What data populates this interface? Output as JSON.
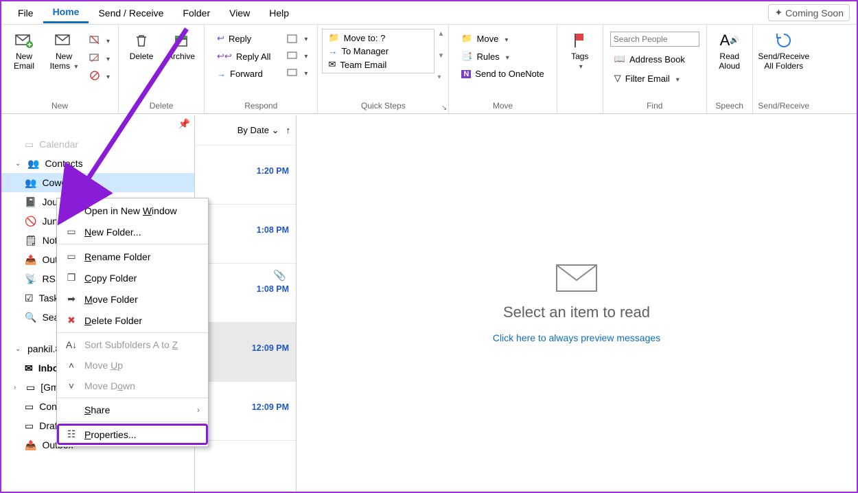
{
  "menu": {
    "file": "File",
    "home": "Home",
    "sendrecv": "Send / Receive",
    "folder": "Folder",
    "view": "View",
    "help": "Help",
    "coming": "Coming Soon"
  },
  "ribbon": {
    "new": {
      "label": "New",
      "email": "New Email",
      "items": "New Items"
    },
    "delete": {
      "label": "Delete",
      "delete": "Delete",
      "archive": "Archive"
    },
    "respond": {
      "label": "Respond",
      "reply": "Reply",
      "replyall": "Reply All",
      "forward": "Forward"
    },
    "quick": {
      "label": "Quick Steps",
      "moveto": "Move to: ?",
      "manager": "To Manager",
      "team": "Team Email"
    },
    "move": {
      "label": "Move",
      "move": "Move",
      "rules": "Rules",
      "onenote": "Send to OneNote"
    },
    "tags": {
      "label": "Tags",
      "tags": "Tags"
    },
    "find": {
      "label": "Find",
      "placeholder": "Search People",
      "address": "Address Book",
      "filter": "Filter Email"
    },
    "speech": {
      "label": "Speech",
      "read": "Read Aloud"
    },
    "sr": {
      "label": "Send/Receive",
      "btn": "Send/Receive All Folders"
    }
  },
  "folders": {
    "calendar": "Calendar",
    "contacts": "Contacts",
    "coworkers": "Coworkers",
    "journal": "Journal",
    "junk": "Junk Email",
    "notes": "Notes",
    "outbox_top": "Outbox",
    "rss": "RSS Feeds",
    "tasks": "Tasks",
    "search": "Search Folders",
    "account": "pankil.8",
    "inbox": "Inbox",
    "gmail": "[Gmail]",
    "conv": "Conversation History",
    "drafts": "Drafts",
    "outbox": "Outbox"
  },
  "msglist": {
    "sort": "By Date",
    "rows": [
      {
        "time": "1:20 PM"
      },
      {
        "time": "1:08 PM"
      },
      {
        "time": "1:08 PM",
        "attach": true
      },
      {
        "time": "12:09 PM",
        "selected": true
      },
      {
        "time": "12:09 PM"
      }
    ]
  },
  "reading": {
    "hint": "Select an item to read",
    "link": "Click here to always preview messages"
  },
  "ctx": {
    "open": "Open in New Window",
    "newfolder": "New Folder...",
    "rename": "Rename Folder",
    "copy": "Copy Folder",
    "movef": "Move Folder",
    "deletef": "Delete Folder",
    "sort": "Sort Subfolders A to Z",
    "moveup": "Move Up",
    "movedown": "Move Down",
    "share": "Share",
    "props": "Properties...",
    "u": {
      "open": "W",
      "new": "N",
      "rename": "R",
      "copy": "C",
      "move": "M",
      "delete": "D",
      "sort": "Z",
      "up": "U",
      "down": "o",
      "share": "S",
      "props": "P"
    }
  }
}
